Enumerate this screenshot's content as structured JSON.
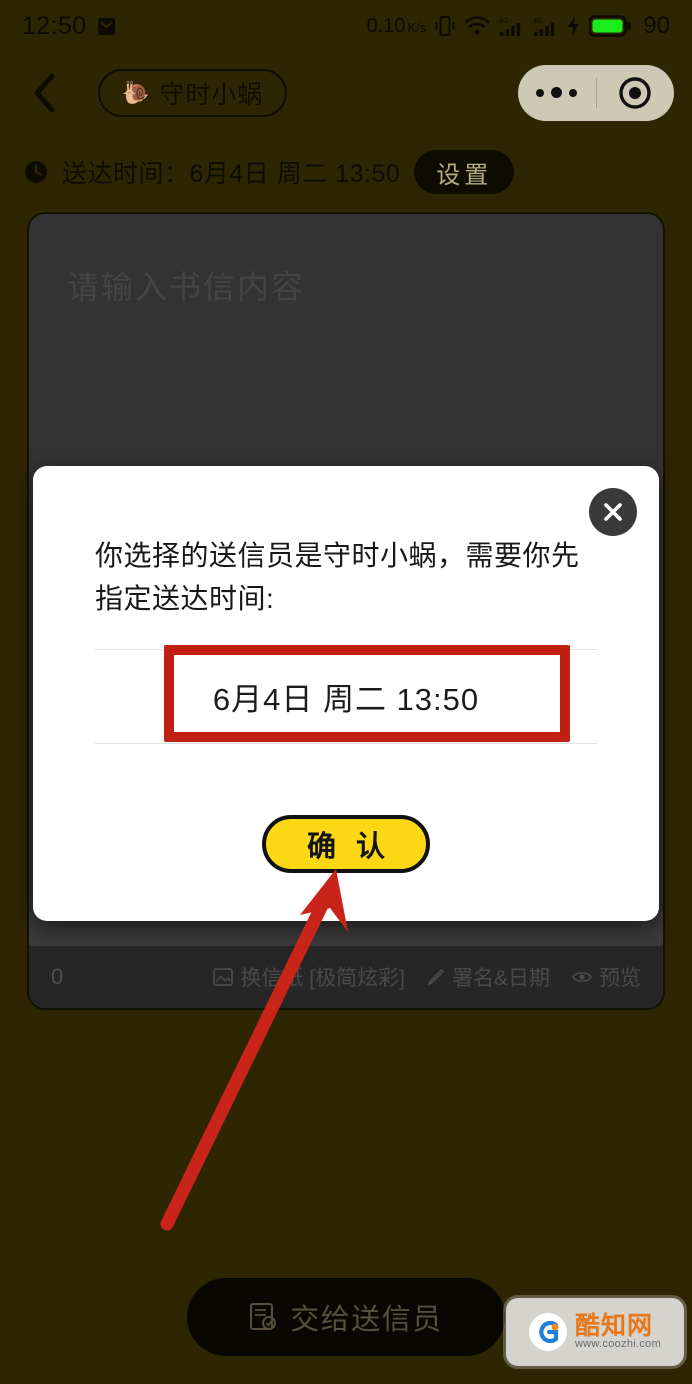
{
  "status_bar": {
    "time": "12:50",
    "mail_icon": "mail-icon",
    "network_speed": "0.10",
    "network_unit": "K/s",
    "vibrate_icon": "vibrate-icon",
    "wifi_icon": "wifi-icon",
    "signal_1_icon": "signal-4g-icon",
    "signal_2_icon": "signal-4g-icon",
    "charging_icon": "charging-bolt-icon",
    "battery_icon": "battery-icon",
    "battery_level": "90"
  },
  "nav_bar": {
    "back_icon": "back-chevron-icon",
    "courier_icon": "snail-icon",
    "courier_name": "守时小蜗",
    "capsule": {
      "more_icon": "more-dots-icon",
      "target_icon": "target-icon"
    }
  },
  "delivery": {
    "clock_icon": "clock-icon",
    "label": "送达时间：6月4日 周二 13:50",
    "settings_label": "设置"
  },
  "letter": {
    "placeholder": "请输入书信内容",
    "char_count": "0",
    "tools": [
      {
        "icon": "image-icon",
        "label": "换信纸 [极简炫彩]"
      },
      {
        "icon": "pen-icon",
        "label": "署名&日期"
      },
      {
        "icon": "eye-icon",
        "label": "预览"
      }
    ]
  },
  "modal": {
    "close_icon": "close-icon",
    "message": "你选择的送信员是守时小蜗，需要你先指定送达时间:",
    "picker_value": "6月4日 周二 13:50",
    "confirm_label": "确 认"
  },
  "annotation": {
    "box_color": "#bf2011",
    "arrow_color": "#c8241a"
  },
  "bottom": {
    "submit_icon": "letter-send-icon",
    "submit_label": "交给送信员"
  },
  "watermark": {
    "logo_icon": "coozhi-logo-icon",
    "title": "酷知网",
    "url": "www.coozhi.com"
  },
  "colors": {
    "page_background": "#2e2603",
    "card_background": "#333333",
    "modal_background": "#ffffff",
    "confirm_yellow": "#fbd714",
    "annotation_red": "#bf2011"
  }
}
